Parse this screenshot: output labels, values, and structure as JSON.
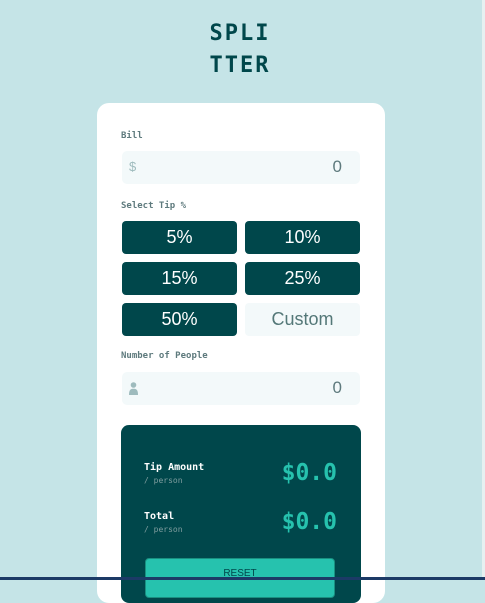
{
  "header": {
    "logo_line1": "SPLI",
    "logo_line2": "TTER"
  },
  "bill": {
    "label": "Bill",
    "prefix_icon": "dollar-icon",
    "prefix": "$",
    "value": "0"
  },
  "tip": {
    "label": "Select Tip %",
    "options": [
      "5%",
      "10%",
      "15%",
      "25%",
      "50%"
    ],
    "custom_placeholder": "Custom"
  },
  "people": {
    "label": "Number of People",
    "icon": "person-icon",
    "value": "0"
  },
  "results": {
    "tip_amount": {
      "label": "Tip Amount",
      "sub": "/ person",
      "value": "$0.0"
    },
    "total": {
      "label": "Total",
      "sub": "/ person",
      "value": "$0.0"
    },
    "reset_label": "RESET"
  },
  "colors": {
    "page_background": "#c5e4e7",
    "dark_cyan": "#00474b",
    "strong_cyan": "#26c2ae",
    "input_background": "#f3f9fa",
    "label_grey": "#5e7a7d"
  }
}
